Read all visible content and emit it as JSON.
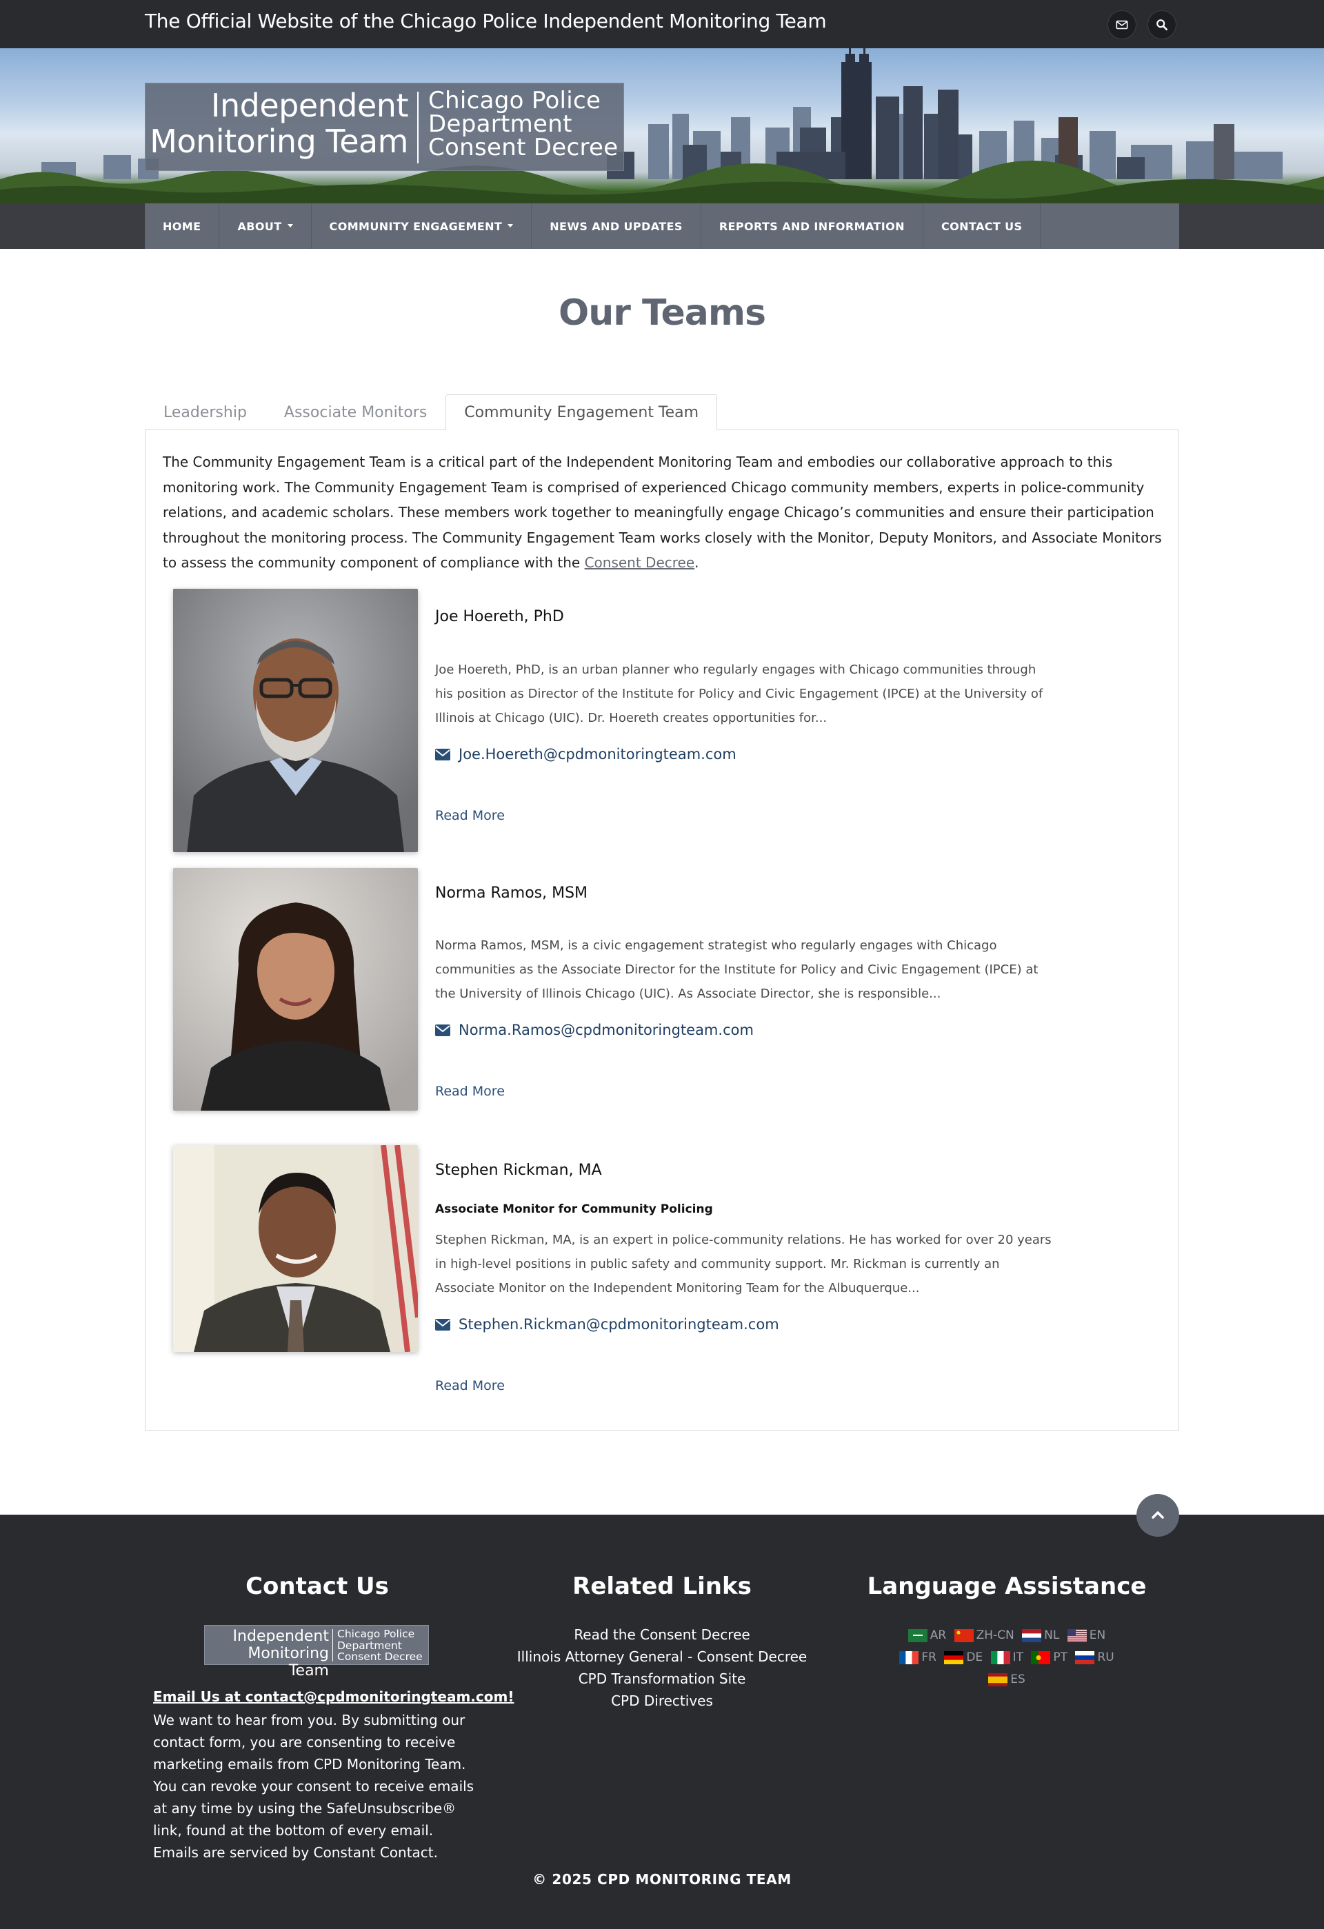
{
  "topbar": {
    "title": "The Official Website of the Chicago Police Independent Monitoring Team",
    "icons": [
      "envelope-icon",
      "search-icon"
    ]
  },
  "hero": {
    "logo_left_line1": "Independent",
    "logo_left_line2": "Monitoring Team",
    "logo_right_line1": "Chicago Police",
    "logo_right_line2": "Department",
    "logo_right_line3": "Consent Decree"
  },
  "nav": {
    "items": [
      {
        "label": "HOME",
        "dropdown": false
      },
      {
        "label": "ABOUT",
        "dropdown": true
      },
      {
        "label": "COMMUNITY ENGAGEMENT",
        "dropdown": true
      },
      {
        "label": "NEWS AND UPDATES",
        "dropdown": false
      },
      {
        "label": "REPORTS AND INFORMATION",
        "dropdown": false
      },
      {
        "label": "CONTACT US",
        "dropdown": false
      }
    ]
  },
  "page": {
    "title": "Our Teams",
    "tabs": [
      "Leadership",
      "Associate Monitors",
      "Community Engagement Team"
    ],
    "active_tab": "Community Engagement Team",
    "intro": "The Community Engagement Team is a critical part of the Independent Monitoring Team and embodies our collaborative approach to this monitoring work. The Community Engagement Team is comprised of experienced Chicago community members, experts in police-community relations, and academic scholars. These members work together to meaningfully engage Chicago’s communities and ensure their participation throughout the monitoring process. The Community Engagement Team works closely with the Monitor, Deputy Monitors, and Associate Monitors to assess the community component of compliance with the ",
    "intro_link": "Consent Decree",
    "intro_end": "."
  },
  "members": [
    {
      "name": "Joe Hoereth, PhD",
      "title": "",
      "bio": "Joe Hoereth, PhD, is an urban planner who regularly engages with Chicago communities through his position as Director of the Institute for Policy and Civic Engagement (IPCE) at the University of Illinois at Chicago (UIC). Dr. Hoereth creates opportunities for...",
      "email": "Joe.Hoereth@cpdmonitoringteam.com",
      "read_more": "Read More"
    },
    {
      "name": "Norma Ramos, MSM",
      "title": "",
      "bio": "Norma Ramos, MSM, is a civic engagement strategist who regularly engages with Chicago communities as the Associate Director for the Institute for Policy and Civic Engagement (IPCE) at the University of Illinois Chicago (UIC). As Associate Director, she is responsible...",
      "email": "Norma.Ramos@cpdmonitoringteam.com",
      "read_more": "Read More"
    },
    {
      "name": "Stephen Rickman, MA",
      "title": "Associate Monitor for Community Policing",
      "bio": "Stephen Rickman, MA, is an expert in police-community relations. He has worked for over 20 years in high-level positions in public safety and community support. Mr. Rickman is currently an Associate Monitor on the Independent Monitoring Team for the Albuquerque...",
      "email": "Stephen.Rickman@cpdmonitoringteam.com",
      "read_more": "Read More"
    }
  ],
  "footer": {
    "contact_title": "Contact Us",
    "links_title": "Related Links",
    "lang_title": "Language Assistance",
    "logo_left_line1": "Independent",
    "logo_left_line2": "Monitoring Team",
    "logo_right_line1": "Chicago Police",
    "logo_right_line2": "Department",
    "logo_right_line3": "Consent Decree",
    "email_link": "Email Us at contact@cpdmonitoringteam.com!",
    "consent_text": "We want to hear from you.  By submitting our contact form, you are consenting to receive marketing emails from CPD Monitoring Team. You can revoke your consent to receive emails at any time by using the SafeUnsubscribe® link, found at the bottom of every email. Emails are serviced by Constant Contact.",
    "links": [
      "Read the Consent Decree",
      "Illinois Attorney General - Consent Decree",
      "CPD Transformation Site",
      "CPD Directives"
    ],
    "languages": [
      "AR",
      "ZH-CN",
      "NL",
      "EN",
      "FR",
      "DE",
      "IT",
      "PT",
      "RU",
      "ES"
    ],
    "copyright": "© 2025 CPD MONITORING TEAM"
  },
  "colors": {
    "topbar_bg": "#2a2b2f",
    "nav_bg": "#636a76",
    "title_color": "#5f6571",
    "link_color": "#1f3f63",
    "footer_bg": "#2a2b2f"
  }
}
